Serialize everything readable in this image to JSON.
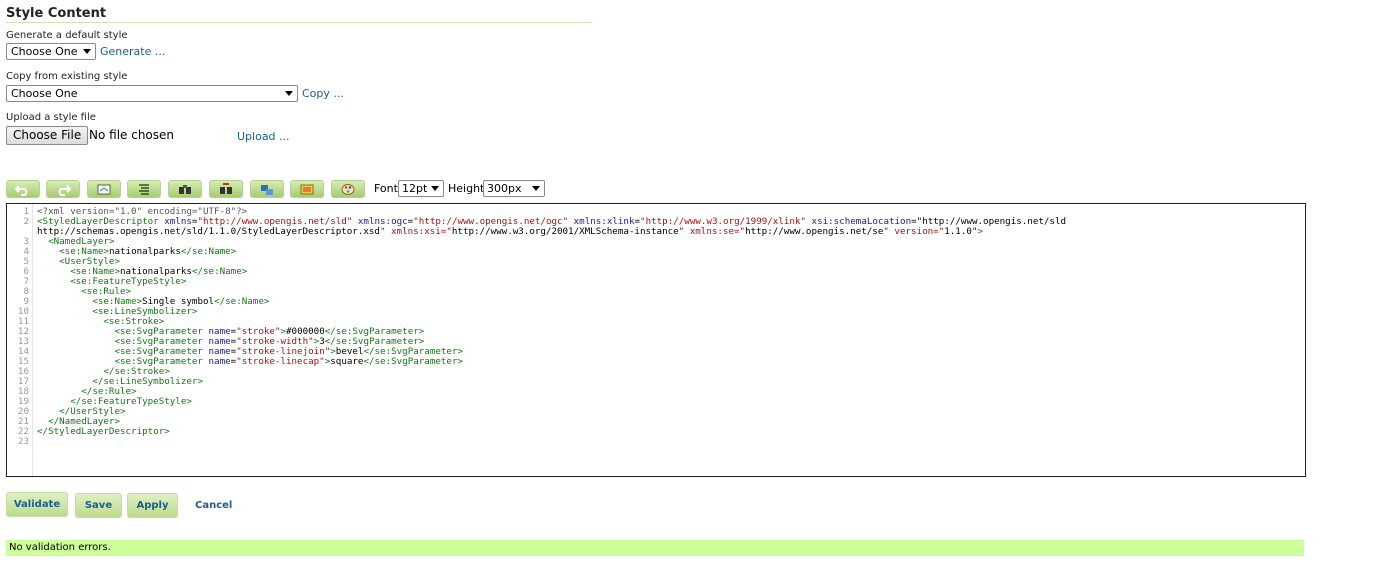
{
  "section": {
    "title": "Style Content"
  },
  "generate": {
    "label": "Generate a default style",
    "select_value": "Choose One",
    "link": "Generate ..."
  },
  "copy": {
    "label": "Copy from existing style",
    "select_value": "Choose One",
    "link": "Copy ..."
  },
  "upload": {
    "label": "Upload a style file",
    "choose_button": "Choose File",
    "file_status": "No file chosen",
    "link": "Upload ..."
  },
  "toolbar": {
    "buttons": [
      {
        "icon": "undo-icon"
      },
      {
        "icon": "redo-icon"
      },
      {
        "icon": "goto-line-icon"
      },
      {
        "icon": "reformat-icon"
      },
      {
        "icon": "find-icon"
      },
      {
        "icon": "replace-icon"
      },
      {
        "icon": "insert-graphic-icon"
      },
      {
        "icon": "legend-image-icon"
      },
      {
        "icon": "color-palette-icon"
      }
    ],
    "font_label": "Font",
    "font_value": "12pt",
    "height_label": "Height",
    "height_value": "300px"
  },
  "editor": {
    "line_numbers": [
      "1",
      "2",
      "",
      "3",
      "4",
      "5",
      "6",
      "7",
      "8",
      "9",
      "10",
      "11",
      "12",
      "13",
      "14",
      "15",
      "16",
      "17",
      "18",
      "19",
      "20",
      "21",
      "22",
      "23"
    ],
    "lines": [
      "<?xml version=\"1.0\" encoding=\"UTF-8\"?>",
      "<StyledLayerDescriptor xmlns=\"http://www.opengis.net/sld\" xmlns:ogc=\"http://www.opengis.net/ogc\" xmlns:xlink=\"http://www.w3.org/1999/xlink\" xsi:schemaLocation=\"http://www.opengis.net/sld",
      "http://schemas.opengis.net/sld/1.1.0/StyledLayerDescriptor.xsd\" xmlns:xsi=\"http://www.w3.org/2001/XMLSchema-instance\" xmlns:se=\"http://www.opengis.net/se\" version=\"1.1.0\">",
      "  <NamedLayer>",
      "    <se:Name>nationalparks</se:Name>",
      "    <UserStyle>",
      "      <se:Name>nationalparks</se:Name>",
      "      <se:FeatureTypeStyle>",
      "        <se:Rule>",
      "          <se:Name>Single symbol</se:Name>",
      "          <se:LineSymbolizer>",
      "            <se:Stroke>",
      "              <se:SvgParameter name=\"stroke\">#000000</se:SvgParameter>",
      "              <se:SvgParameter name=\"stroke-width\">3</se:SvgParameter>",
      "              <se:SvgParameter name=\"stroke-linejoin\">bevel</se:SvgParameter>",
      "              <se:SvgParameter name=\"stroke-linecap\">square</se:SvgParameter>",
      "            </se:Stroke>",
      "          </se:LineSymbolizer>",
      "        </se:Rule>",
      "      </se:FeatureTypeStyle>",
      "    </UserStyle>",
      "  </NamedLayer>",
      "</StyledLayerDescriptor>",
      ""
    ]
  },
  "actions": {
    "validate": "Validate",
    "save": "Save",
    "apply": "Apply",
    "cancel": "Cancel"
  },
  "status": {
    "message": "No validation errors."
  },
  "colors": {
    "accent_link": "#1a5e8f",
    "button_green": "#bcdb8d",
    "status_bg": "#ccff99"
  }
}
